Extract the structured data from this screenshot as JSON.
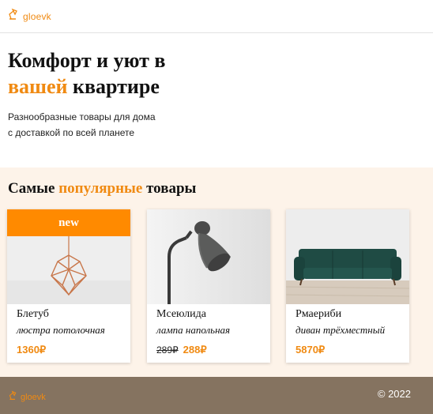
{
  "header": {
    "logo_text": "gloevk",
    "logo_icon": "desk-lamp-icon"
  },
  "hero": {
    "title_line1": "Комфорт и уют в",
    "title_accent": "вашей",
    "title_rest": " квартире",
    "subtitle_line1": "Разнообразные товары для дома",
    "subtitle_line2": "с доставкой по всей планете"
  },
  "popular": {
    "title_start": "Самые ",
    "title_accent": "популярные",
    "title_end": " товары",
    "products": [
      {
        "badge": "new",
        "name": "Блетуб",
        "type": "люстра потолочная",
        "price": "1360₽",
        "image": "pendant-lamp-image"
      },
      {
        "name": "Мсеюлида",
        "type": "лампа напольная",
        "old_price": "289₽",
        "price": "288₽",
        "image": "floor-lamp-image"
      },
      {
        "name": "Рмаериби",
        "type": "диван трёхместный",
        "price": "5870₽",
        "image": "sofa-image"
      }
    ]
  },
  "footer": {
    "logo_text": "gloevk",
    "copyright": "© 2022"
  },
  "colors": {
    "accent": "#f08a12",
    "badge": "#ff8a00",
    "section_bg": "#fdf3e9",
    "footer_bg": "#857360"
  }
}
